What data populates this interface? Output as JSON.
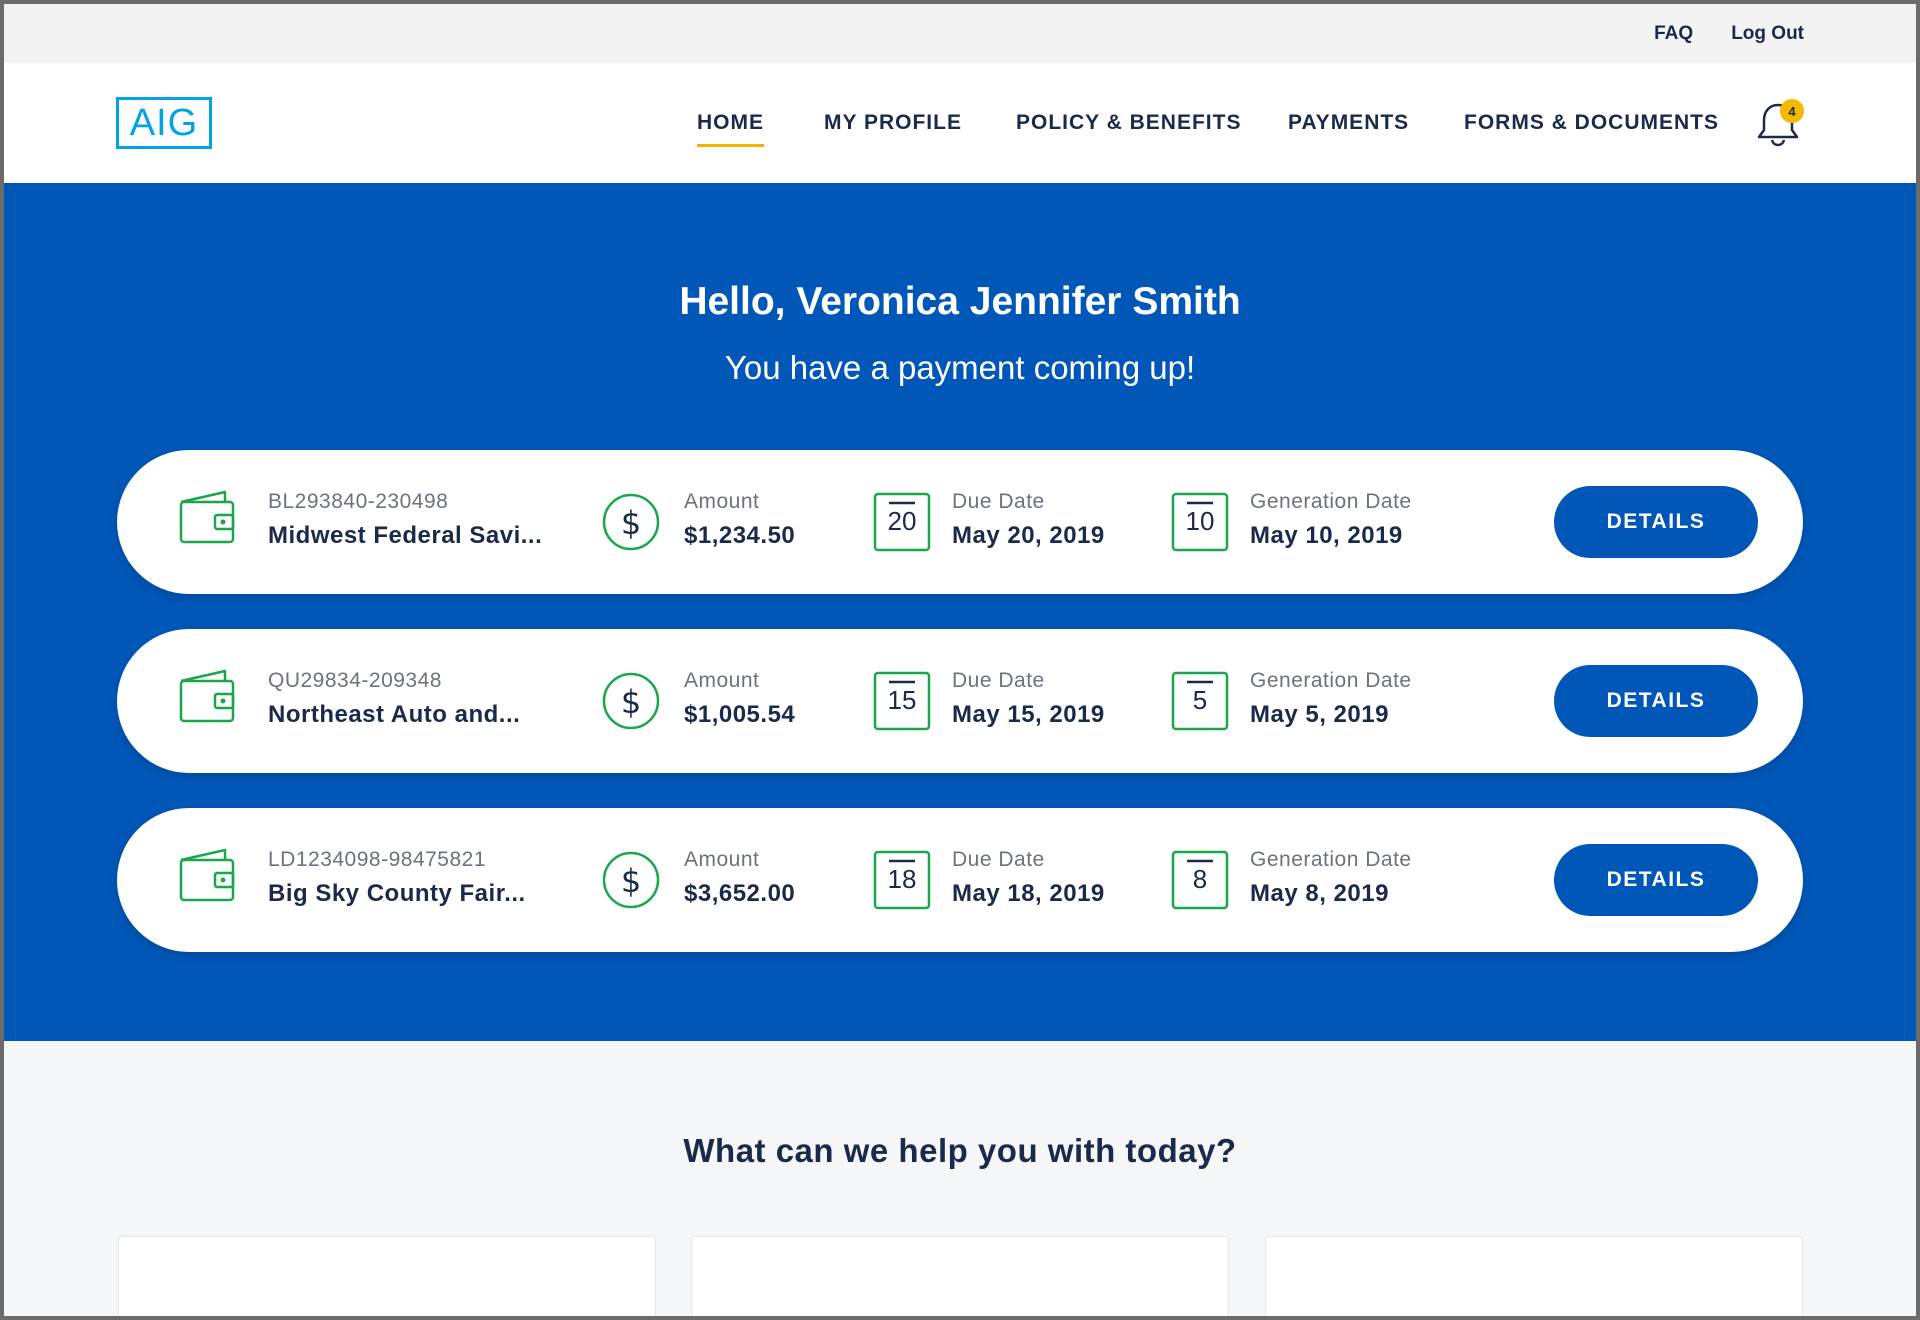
{
  "util": {
    "faq": "FAQ",
    "logout": "Log Out"
  },
  "logo": {
    "text": "AIG"
  },
  "nav": {
    "items": [
      {
        "label": "HOME"
      },
      {
        "label": "MY PROFILE"
      },
      {
        "label": "POLICY & BENEFITS"
      },
      {
        "label": "PAYMENTS"
      },
      {
        "label": "FORMS & DOCUMENTS"
      }
    ],
    "notifications": "4"
  },
  "hero": {
    "title": "Hello, Veronica Jennifer Smith",
    "subtitle": "You have a payment coming up!"
  },
  "payments": [
    {
      "policy_id": "BL293840-230498",
      "policy_name": "Midwest Federal Savi...",
      "amount_label": "Amount",
      "amount": "$1,234.50",
      "due_label": "Due Date",
      "due_day": "20",
      "due_date": "May 20, 2019",
      "gen_label": "Generation Date",
      "gen_day": "10",
      "gen_date": "May 10, 2019",
      "button": "DETAILS"
    },
    {
      "policy_id": "QU29834-209348",
      "policy_name": "Northeast Auto and...",
      "amount_label": "Amount",
      "amount": "$1,005.54",
      "due_label": "Due Date",
      "due_day": "15",
      "due_date": "May 15, 2019",
      "gen_label": "Generation Date",
      "gen_day": "5",
      "gen_date": "May 5, 2019",
      "button": "DETAILS"
    },
    {
      "policy_id": "LD1234098-98475821",
      "policy_name": "Big Sky County Fair...",
      "amount_label": "Amount",
      "amount": "$3,652.00",
      "due_label": "Due Date",
      "due_day": "18",
      "due_date": "May 18, 2019",
      "gen_label": "Generation Date",
      "gen_day": "8",
      "gen_date": "May 8, 2019",
      "button": "DETAILS"
    }
  ],
  "help": {
    "title": "What can we help you with today?"
  },
  "icons": {
    "wallet": "wallet-icon",
    "dollar": "dollar-circle-icon",
    "calendar": "calendar-icon",
    "bell": "bell-icon"
  },
  "colors": {
    "brand_blue": "#0057b8",
    "logo_blue": "#00a4e4",
    "icon_green": "#1aa64b",
    "accent_yellow": "#f2b400",
    "text_dark": "#1b2a4a"
  }
}
